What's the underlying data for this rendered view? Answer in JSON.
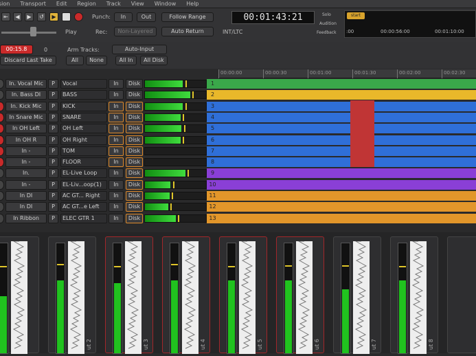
{
  "menu": [
    "sion",
    "Transport",
    "Edit",
    "Region",
    "Track",
    "View",
    "Window",
    "Help"
  ],
  "transport": {
    "punch_label": "Punch:",
    "in_label": "In",
    "out_label": "Out",
    "play_label": "Play",
    "rec_label": "Rec:",
    "non_layered": "Non-Layered",
    "follow_range": "Follow Range",
    "auto_return": "Auto Return",
    "clock": "00:01:43:21",
    "int_ltc": "INT/LTC",
    "solo": "Solo",
    "audition": "Audition",
    "feedback": "Feedback",
    "start": "start",
    "mini_times": [
      ":00",
      "00:00:56:00",
      "00:01:10:00"
    ]
  },
  "toolbar": {
    "red_value": "00:15.8",
    "zero": "0",
    "discard_last_take": "Discard Last Take",
    "arm_tracks_label": "Arm Tracks:",
    "auto_input": "Auto-Input",
    "all": "All",
    "none": "None",
    "all_in": "All In",
    "all_disk": "All Disk"
  },
  "ruler_ticks": [
    "00:00:00",
    "00:00:30",
    "00:01:00",
    "00:01:30",
    "00:02:00",
    "00:02:30"
  ],
  "tracks": [
    {
      "input": "In. Vocal Mic",
      "p": "P",
      "name": "Vocal",
      "in": "In",
      "disk": "Disk",
      "num": "1",
      "color": "#3aa84a",
      "level": 0.62,
      "rec": false
    },
    {
      "input": "In. Bass DI",
      "p": "P",
      "name": "BASS",
      "in": "In",
      "disk": "Disk",
      "num": "2",
      "color": "#e9b82a",
      "level": 0.74,
      "rec": false
    },
    {
      "input": "In. Kick Mic",
      "p": "P",
      "name": "KICK",
      "in": "In",
      "disk": "Disk",
      "num": "3",
      "color": "#2f6fd8",
      "level": 0.62,
      "rec": true
    },
    {
      "input": "In Snare Mic",
      "p": "P",
      "name": "SNARE",
      "in": "In",
      "disk": "Disk",
      "num": "4",
      "color": "#2f6fd8",
      "level": 0.58,
      "rec": true
    },
    {
      "input": "In OH Left",
      "p": "P",
      "name": "OH Left",
      "in": "In",
      "disk": "Disk",
      "num": "5",
      "color": "#2f6fd8",
      "level": 0.6,
      "rec": true
    },
    {
      "input": "In OH R",
      "p": "P",
      "name": "OH Right",
      "in": "In",
      "disk": "Disk",
      "num": "6",
      "color": "#2f6fd8",
      "level": 0.58,
      "rec": true
    },
    {
      "input": "In -",
      "p": "P",
      "name": "TOM",
      "in": "In",
      "disk": "Disk",
      "num": "7",
      "color": "#2f6fd8",
      "level": 0.0,
      "rec": true
    },
    {
      "input": "In -",
      "p": "P",
      "name": "FLOOR",
      "in": "In",
      "disk": "Disk",
      "num": "8",
      "color": "#2f6fd8",
      "level": 0.0,
      "rec": true
    },
    {
      "input": "In.",
      "p": "P",
      "name": "EL-Live Loop",
      "in": "In",
      "disk": "Disk",
      "num": "9",
      "color": "#8a3fd6",
      "level": 0.66,
      "rec": false
    },
    {
      "input": "In -",
      "p": "P",
      "name": "EL-Liv...oop(1)",
      "in": "In",
      "disk": "Disk",
      "num": "10",
      "color": "#8a3fd6",
      "level": 0.42,
      "rec": false
    },
    {
      "input": "In DI",
      "p": "P",
      "name": "AC GT... Right",
      "in": "In",
      "disk": "Disk",
      "num": "11",
      "color": "#e2962a",
      "level": 0.4,
      "rec": false
    },
    {
      "input": "In DI",
      "p": "P",
      "name": "AC GT...e Left",
      "in": "In",
      "disk": "Disk",
      "num": "12",
      "color": "#e2962a",
      "level": 0.38,
      "rec": false
    },
    {
      "input": "In Ribbon",
      "p": "P",
      "name": "ELEC GTR 1",
      "in": "In",
      "disk": "Disk",
      "num": "13",
      "color": "#e2962a",
      "level": 0.5,
      "rec": false
    }
  ],
  "mixer": [
    {
      "name": "",
      "level": 0.52,
      "peak": 0.78,
      "selected": false
    },
    {
      "name": "ut 2",
      "level": 0.66,
      "peak": 0.8,
      "selected": false
    },
    {
      "name": "ut 3",
      "level": 0.64,
      "peak": 0.78,
      "selected": true
    },
    {
      "name": "ut 4",
      "level": 0.66,
      "peak": 0.8,
      "selected": true
    },
    {
      "name": "ut 5",
      "level": 0.66,
      "peak": 0.78,
      "selected": true
    },
    {
      "name": "ut 6",
      "level": 0.66,
      "peak": 0.79,
      "selected": true
    },
    {
      "name": "ut 7",
      "level": 0.58,
      "peak": 0.79,
      "selected": false
    },
    {
      "name": "ut 8",
      "level": 0.66,
      "peak": 0.78,
      "selected": false
    }
  ],
  "colors": {
    "rec_red": "#c92a2a",
    "selection_red": "#c03535",
    "accent_orange": "#e08a2a"
  }
}
